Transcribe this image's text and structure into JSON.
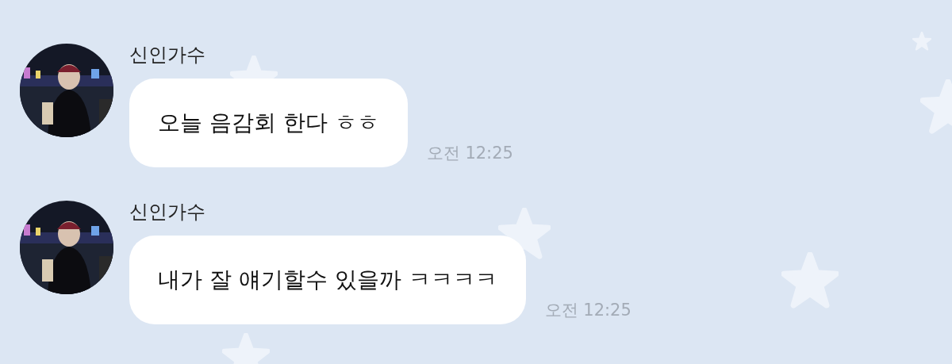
{
  "messages": [
    {
      "sender": "신인가수",
      "text": "오늘 음감회 한다 ㅎㅎ",
      "time": "오전 12:25"
    },
    {
      "sender": "신인가수",
      "text": "내가 잘 얘기할수 있을까 ㅋㅋㅋㅋ",
      "time": "오전 12:25"
    }
  ]
}
